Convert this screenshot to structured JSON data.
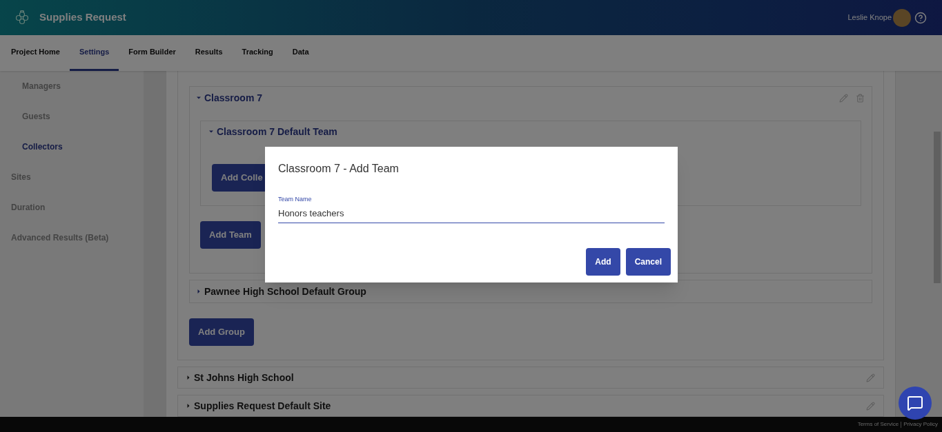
{
  "header": {
    "title": "Supplies Request",
    "user": "Leslie Knope"
  },
  "tabs": [
    {
      "label": "Project Home",
      "selected": false
    },
    {
      "label": "Settings",
      "selected": true
    },
    {
      "label": "Form Builder",
      "selected": false
    },
    {
      "label": "Results",
      "selected": false
    },
    {
      "label": "Tracking",
      "selected": false
    },
    {
      "label": "Data",
      "selected": false
    }
  ],
  "sidebar": {
    "sub_items": [
      {
        "label": "Managers",
        "selected": false
      },
      {
        "label": "Guests",
        "selected": false
      },
      {
        "label": "Collectors",
        "selected": true
      }
    ],
    "items": [
      {
        "label": "Sites",
        "selected": false
      },
      {
        "label": "Duration",
        "selected": false
      },
      {
        "label": "Advanced Results (Beta)",
        "selected": false
      }
    ]
  },
  "open_site": {
    "groups": [
      {
        "name": "Classroom 7",
        "expanded": true,
        "teams": [
          {
            "name": "Classroom 7 Default Team",
            "expanded": true,
            "button": "Add Colle"
          }
        ],
        "button": "Add Team"
      },
      {
        "name": "Pawnee High School Default Group",
        "expanded": false
      }
    ],
    "button": "Add Group"
  },
  "sites": [
    {
      "name": "St Johns High School",
      "expanded": false
    },
    {
      "name": "Supplies Request Default Site",
      "expanded": false
    }
  ],
  "dialog": {
    "title": "Classroom 7 - Add Team",
    "field_label": "Team Name",
    "field_value": "Honors teachers",
    "buttons": [
      "Add",
      "Cancel"
    ]
  },
  "footer": {
    "links": [
      "Terms of Service",
      "Privacy Policy"
    ]
  }
}
